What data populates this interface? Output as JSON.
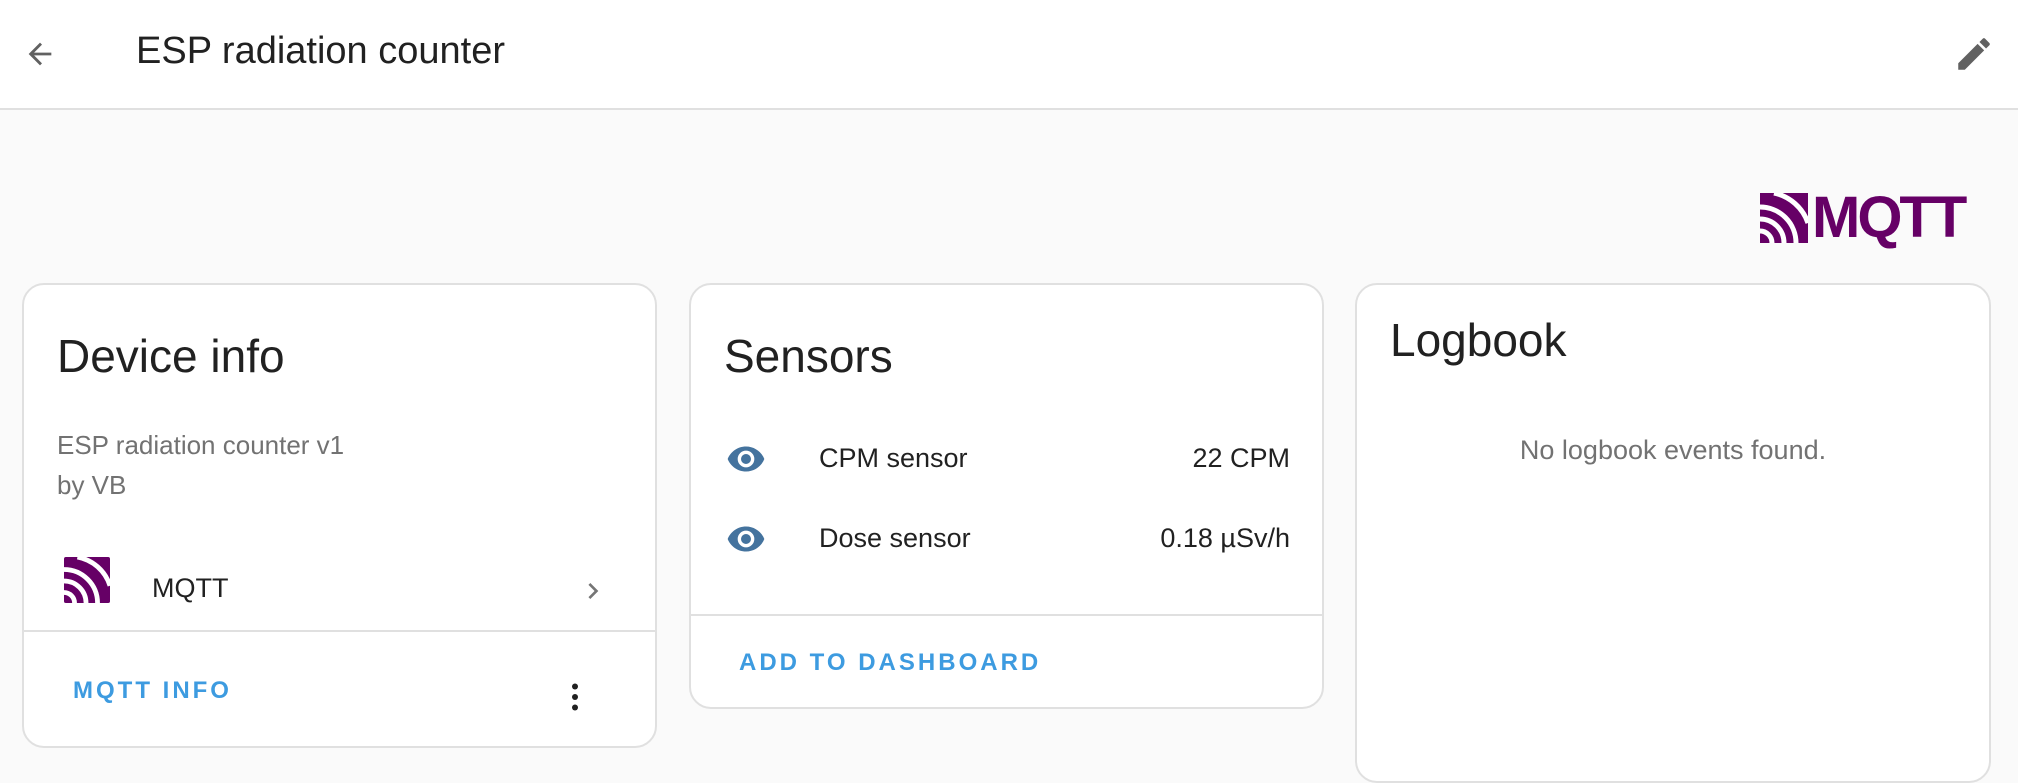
{
  "header": {
    "title": "ESP radiation counter",
    "back_icon": "arrow-left-icon",
    "edit_icon": "pencil-icon"
  },
  "brand": {
    "name": "MQTT",
    "color": "#660066"
  },
  "device_info": {
    "title": "Device info",
    "model": "ESP radiation counter v1",
    "manufacturer": "by VB",
    "integration": {
      "label": "MQTT",
      "icon": "mqtt-logo-icon"
    },
    "action_label": "MQTT INFO",
    "overflow_icon": "dots-vertical-icon"
  },
  "sensors": {
    "title": "Sensors",
    "items": [
      {
        "name": "CPM sensor",
        "value": "22 CPM",
        "icon": "eye-icon"
      },
      {
        "name": "Dose sensor",
        "value": "0.18 µSv/h",
        "icon": "eye-icon"
      }
    ],
    "action_label": "ADD TO DASHBOARD"
  },
  "logbook": {
    "title": "Logbook",
    "empty_message": "No logbook events found."
  },
  "colors": {
    "accent": "#3d9be0",
    "icon_blue": "#44739e",
    "brand_purple": "#660066"
  }
}
